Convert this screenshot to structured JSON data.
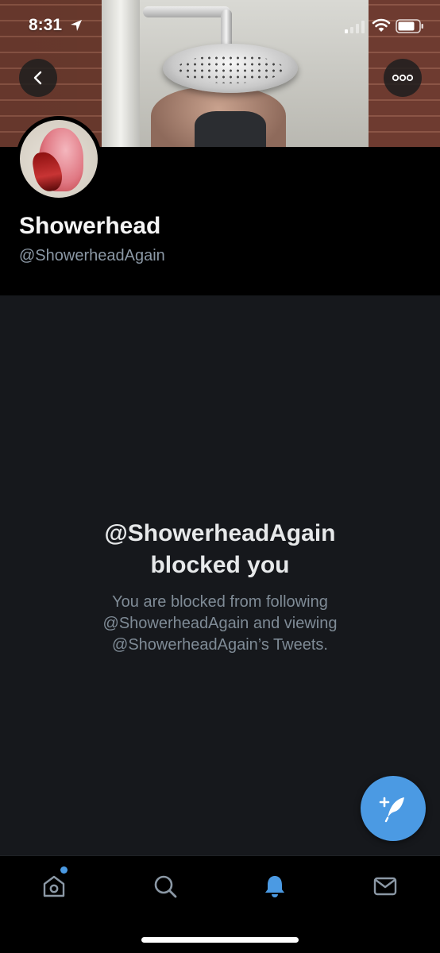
{
  "status_bar": {
    "time": "8:31"
  },
  "header": {
    "back_icon": "chevron-left-icon",
    "more_icon": "ellipsis-icon"
  },
  "profile": {
    "display_name": "Showerhead",
    "handle": "@ShowerheadAgain"
  },
  "blocked": {
    "title_line1": "@ShowerheadAgain",
    "title_line2": "blocked you",
    "desc_line1": "You are blocked from following",
    "desc_line2": "@ShowerheadAgain and viewing",
    "desc_line3": "@ShowerheadAgain’s Tweets."
  },
  "fab": {
    "icon": "compose-tweet-icon",
    "color": "#4b9ae3"
  },
  "tab_bar": {
    "tabs": [
      {
        "name": "home",
        "icon": "home-icon",
        "active": false,
        "has_dot": true
      },
      {
        "name": "search",
        "icon": "search-icon",
        "active": false
      },
      {
        "name": "notifications",
        "icon": "bell-icon",
        "active": true
      },
      {
        "name": "messages",
        "icon": "mail-icon",
        "active": false
      }
    ],
    "active_color": "#4b9ae3",
    "inactive_color": "#8b98a5"
  }
}
